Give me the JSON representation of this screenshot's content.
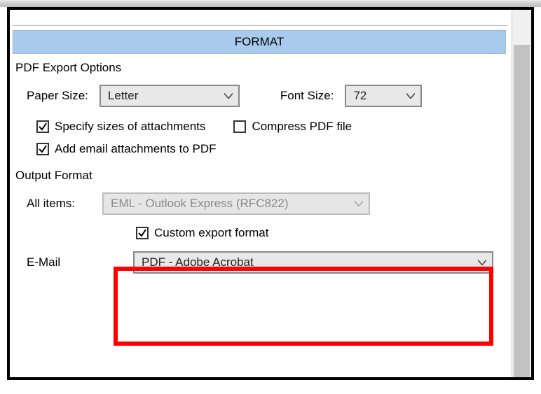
{
  "header": {
    "title": "FORMAT"
  },
  "pdfExport": {
    "group_label": "PDF Export Options",
    "paper_size_label": "Paper Size:",
    "paper_size_value": "Letter",
    "font_size_label": "Font Size:",
    "font_size_value": "72",
    "specify_sizes_label": "Specify sizes of attachments",
    "specify_sizes_checked": true,
    "compress_label": "Compress PDF file",
    "compress_checked": false,
    "add_attachments_label": "Add email attachments to PDF",
    "add_attachments_checked": true
  },
  "outputFormat": {
    "group_label": "Output Format",
    "all_items_label": "All items:",
    "all_items_value": "EML - Outlook Express (RFC822)",
    "custom_export_label": "Custom export format",
    "custom_export_checked": true,
    "email_label": "E-Mail",
    "email_value": "PDF - Adobe Acrobat"
  }
}
